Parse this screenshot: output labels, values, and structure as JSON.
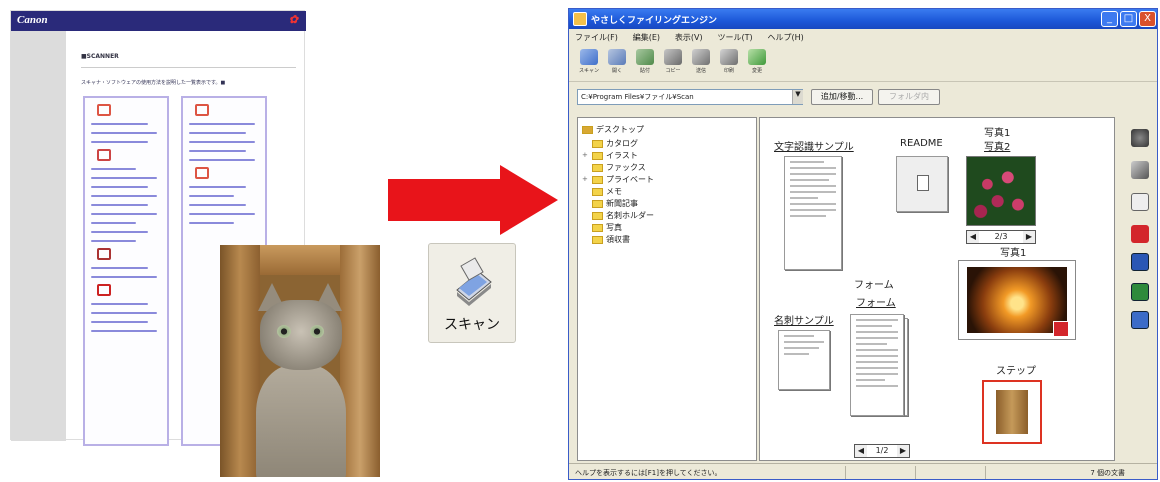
{
  "webpage": {
    "brand": "Canon",
    "heading": "■SCANNER",
    "intro": "スキャナ・ソフトウェアの使用方法を説明した一覧表示です。■"
  },
  "arrow_color": "#e8141a",
  "scan_button": {
    "label": "スキャン",
    "icon": "scanner-icon"
  },
  "window": {
    "title": "やさしくファイリングエンジン",
    "controls": [
      "_",
      "□",
      "X"
    ],
    "menu": [
      "ファイル(F)",
      "編集(E)",
      "表示(V)",
      "ツール(T)",
      "ヘルプ(H)"
    ],
    "toolbar": [
      {
        "label": "スキャン",
        "icon": "scanner-icon"
      },
      {
        "label": "開く",
        "icon": "open-icon"
      },
      {
        "label": "貼付",
        "icon": "stamp-icon"
      },
      {
        "label": "コピー",
        "icon": "copy-icon"
      },
      {
        "label": "送信",
        "icon": "mail-icon"
      },
      {
        "label": "印刷",
        "icon": "print-icon"
      },
      {
        "label": "変更",
        "icon": "edit-icon"
      }
    ],
    "path": {
      "value": "C:¥Program Files¥ファイル¥Scan",
      "button_add": "追加/移動...",
      "button_disabled": "フォルダ内"
    },
    "tree": [
      {
        "label": "デスクトップ",
        "level": 0
      },
      {
        "label": "カタログ",
        "level": 1
      },
      {
        "label": "イラスト",
        "level": 1
      },
      {
        "label": "ファックス",
        "level": 1
      },
      {
        "label": "プライベート",
        "level": 1
      },
      {
        "label": "メモ",
        "level": 1
      },
      {
        "label": "新聞記事",
        "level": 1
      },
      {
        "label": "名刺ホルダー",
        "level": 1
      },
      {
        "label": "写真",
        "level": 1
      },
      {
        "label": "領収書",
        "level": 1
      }
    ],
    "items": {
      "doc1": "文字認識サンプル",
      "readme": "README",
      "photo_title": "写真1",
      "photo_sub": "写真2",
      "photo_nav": "2/3",
      "card": "名刺サンプル",
      "form_title": "フォーム",
      "form_sub": "フォーム",
      "form_nav": "1/2",
      "photo1": "写真1",
      "step": "ステップ"
    },
    "status": {
      "left": "ヘルプを表示するには[F1]を押してください。",
      "right": "7 個の文書"
    },
    "sidebar_icons": [
      "camera-icon",
      "scanner-icon",
      "ocr-icon",
      "pdf-icon",
      "word-icon",
      "excel-icon",
      "print-icon"
    ]
  }
}
